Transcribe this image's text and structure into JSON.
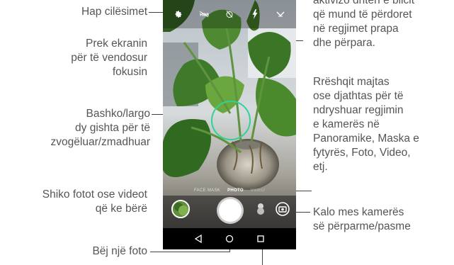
{
  "labels": {
    "settings": "Hap cilësimet",
    "focus": [
      "Prek ekranin",
      "për të vendosur",
      "fokusin"
    ],
    "zoom": [
      "Bashko/largo",
      "dy gishta për të",
      "zvogëluar/zmadhuar"
    ],
    "gallery": [
      "Shiko fotot ose videot",
      "që ke bërë"
    ],
    "capture": "Bëj një foto",
    "flash": [
      "aktivizo dritën e blicit",
      "që mund të përdoret",
      "në  regjimet  prapa",
      "dhe përpara."
    ],
    "swipe": [
      "Rrëshqit majtas",
      "ose djathtas për të",
      "ndryshuar regjimin",
      "e kamerës në",
      "Panoramike, Maska e",
      "fytyrës, Foto, Video,",
      "etj."
    ],
    "switch_camera": [
      "Kalo mes kamerës",
      "së përparme/pasme"
    ]
  },
  "camera": {
    "modes": [
      "FACE MASK",
      "PHOTO",
      "VIDEO"
    ],
    "active_mode": "PHOTO",
    "top_icons": [
      "gear-icon",
      "hdr-off-icon",
      "timer-off-icon",
      "flash-icon",
      "chevron-icon"
    ],
    "nav_icons": [
      "back-triangle-icon",
      "home-circle-icon",
      "recents-square-icon"
    ]
  },
  "colors": {
    "focus_ring": "#2fd296",
    "leader_lines": "#444444",
    "label_text": "#555555"
  }
}
